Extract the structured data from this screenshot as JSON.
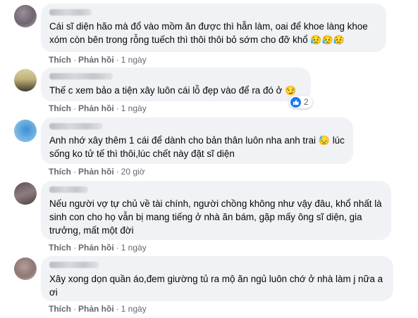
{
  "comments": [
    {
      "text": "Cái sĩ diện hão mà đổ vào mồm ăn được thì hẵn làm, oai để khoe làng khoe xóm còn bên trong rỗng tuếch thì thôi thôi bỏ sớm cho đỡ khổ",
      "emoji": "😥😥😥",
      "like": "Thích",
      "reply": "Phản hồi",
      "time": "1 ngày"
    },
    {
      "text": "Thế c xem bảo a tiện xây luôn cái lỗ đẹp vào để ra đó ở",
      "emoji": "😏",
      "like": "Thích",
      "reply": "Phản hồi",
      "time": "1 ngày",
      "reaction_count": "2"
    },
    {
      "text_before": "Anh nhớ xây thêm 1 cái để dành cho bản thân luôn nha anh trai",
      "emoji": "😓",
      "text_after": "lúc sống ko tử tế thì thôi,lúc chết này đặt sĩ diện",
      "like": "Thích",
      "reply": "Phản hồi",
      "time": "20 giờ"
    },
    {
      "text": "Nếu người vợ tự chủ về tài chính, người chồng không như vậy đâu, khổ nhất là sinh con cho họ vẫn bị mang tiếng ở nhà ăn bám, gặp mấy ông sĩ diện, gia trưởng, mất một đời",
      "like": "Thích",
      "reply": "Phản hồi",
      "time": "1 ngày"
    },
    {
      "text": "Xây xong dọn quần áo,đem giường tủ ra mộ ăn ngủ luôn chớ ở nhà làm j nữa a ơi",
      "like": "Thích",
      "reply": "Phản hồi",
      "time": "1 ngày"
    }
  ],
  "separator": "·",
  "colors": {
    "bubble": "#f0f2f5",
    "meta": "#65676b",
    "like_blue": "#1877f2"
  },
  "icons": {
    "reaction": "like-thumb-icon"
  }
}
